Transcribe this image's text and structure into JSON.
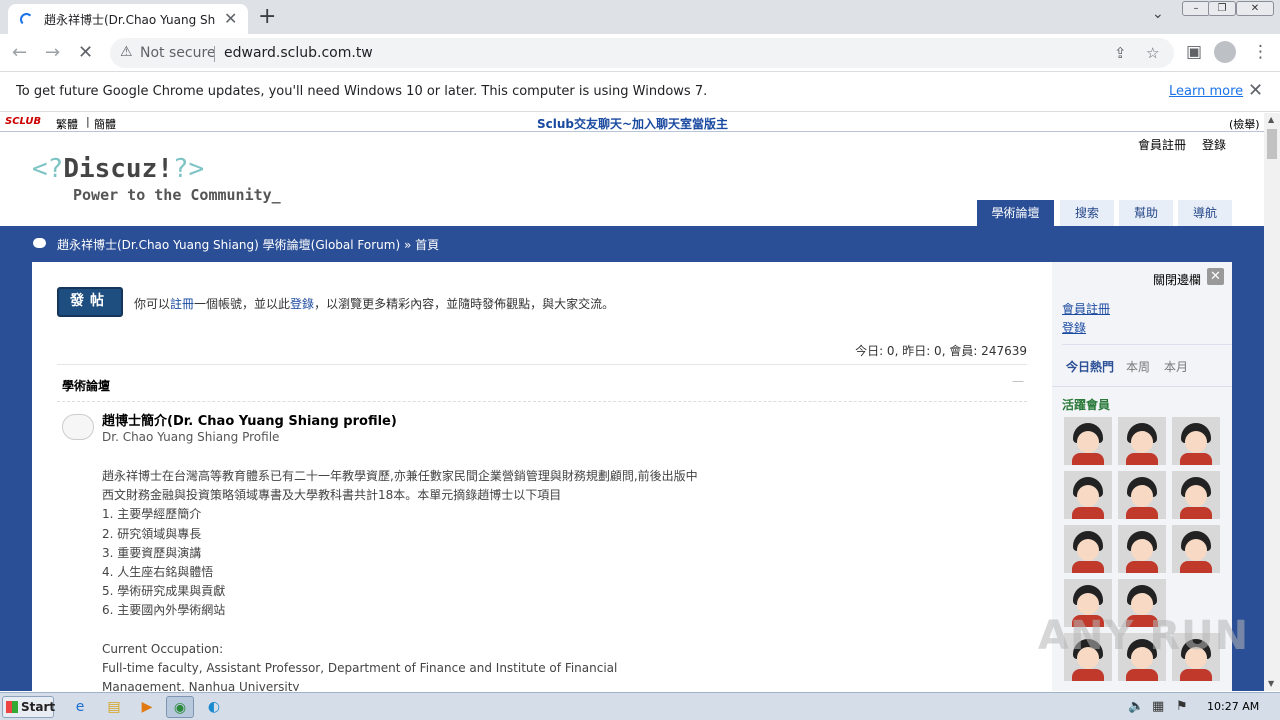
{
  "browser": {
    "tab_title": "趙永祥博士(Dr.Chao Yuang Shiang)",
    "tab_close": "✕",
    "new_tab": "+",
    "not_secure": "Not secure",
    "url": "edward.sclub.com.tw",
    "infobar_message": "To get future Google Chrome updates, you'll need Windows 10 or later. This computer is using Windows 7.",
    "learn_more": "Learn more",
    "icons": [
      "spinner-icon",
      "close-icon",
      "plus-icon",
      "chevron-down-icon",
      "back-icon",
      "forward-icon",
      "stop-icon",
      "warning-icon",
      "share-icon",
      "star-icon",
      "sidebar-icon",
      "profile-icon",
      "menu-icon"
    ]
  },
  "site_bar": {
    "logo": "SCLUB",
    "traditional": "繁體",
    "separator": "|",
    "simplified": "簡體",
    "promo": "Sclub交友聊天~加入聊天室當版主",
    "search": "(檢舉)"
  },
  "header": {
    "logo_main": "Discuz!",
    "logo_open": "<?",
    "logo_close": "?>",
    "logo_tagline": "Power to the Community_",
    "register": "會員註冊",
    "login": "登錄",
    "nav": [
      {
        "label": "學術論壇"
      },
      {
        "label": "搜索"
      },
      {
        "label": "幫助"
      },
      {
        "label": "導航"
      }
    ]
  },
  "breadcrumb": "趙永祥博士(Dr.Chao Yuang Shiang) 學術論壇(Global Forum) » 首頁",
  "main": {
    "post_button": "發帖",
    "invite_pre": "你可以",
    "invite_reg": "註冊",
    "invite_mid": "一個帳號，並以此",
    "invite_login": "登錄",
    "invite_post": "，以瀏覽更多精彩內容，並隨時發佈觀點，與大家交流。",
    "stats": "今日: 0, 昨日: 0, 會員: 247639",
    "forum_category": "學術論壇",
    "collapse": "—",
    "forum_title": "趙博士簡介(Dr. Chao Yuang Shiang profile)",
    "forum_subtitle": "Dr. Chao Yuang Shiang Profile",
    "desc_lines": [
      "趙永祥博士在台灣高等教育體系已有二十一年教學資歷,亦兼任數家民間企業營銷管理與財務規劃顧問,前後出版中",
      "西文財務金融與投資策略領域專書及大學教科書共計18本。本單元摘錄趙博士以下項目",
      "1. 主要學經歷簡介",
      "2. 研究領域與專長",
      "3. 重要資歷與演講",
      "4. 人生座右銘與體悟",
      "5. 學術研究成果與貢獻",
      "6. 主要國內外學術網站",
      "",
      "Current Occupation:",
      "Full-time faculty, Assistant Professor, Department of Finance and Institute of Financial",
      "Management, Nanhua University"
    ]
  },
  "sidebar": {
    "close": "關閉邊欄",
    "close_x": "✕",
    "register": "會員註冊",
    "login": "登錄",
    "tabs": [
      "今日熱門",
      "本周",
      "本月"
    ],
    "active_members": "活躍會員"
  },
  "watermark": "ANY RUN",
  "taskbar": {
    "start": "Start",
    "clock": "10:27 AM",
    "apps": [
      "ie-icon",
      "explorer-icon",
      "media-icon",
      "chrome-icon",
      "edge-icon"
    ]
  }
}
